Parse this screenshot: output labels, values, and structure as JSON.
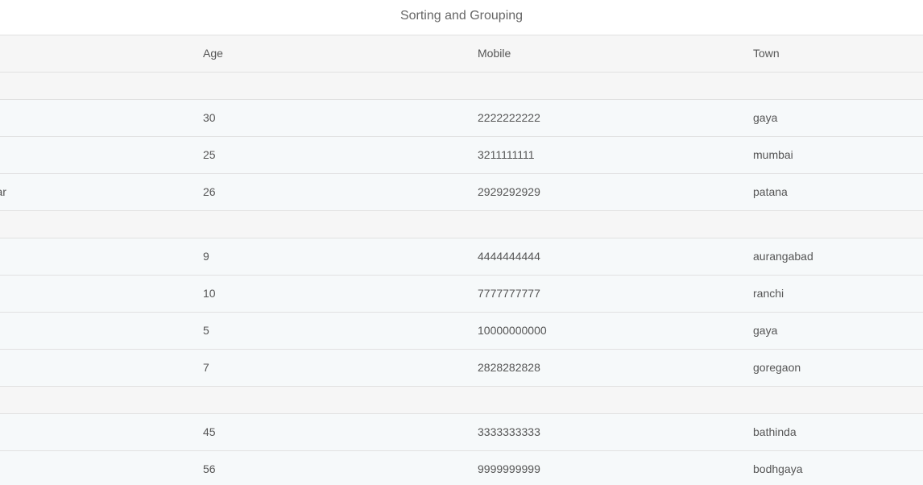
{
  "title": "Sorting and Grouping",
  "columns": {
    "age": "Age",
    "mobile": "Mobile",
    "town": "Town"
  },
  "groups": [
    {
      "rows": [
        {
          "name": "",
          "age": "30",
          "mobile": "2222222222",
          "town": "gaya"
        },
        {
          "name": "",
          "age": "25",
          "mobile": "3211111111",
          "town": "mumbai"
        },
        {
          "name": "kumar",
          "age": "26",
          "mobile": "2929292929",
          "town": "patana"
        }
      ]
    },
    {
      "rows": [
        {
          "name": "",
          "age": "9",
          "mobile": "4444444444",
          "town": "aurangabad"
        },
        {
          "name": "",
          "age": "10",
          "mobile": "7777777777",
          "town": "ranchi"
        },
        {
          "name": "",
          "age": "5",
          "mobile": "10000000000",
          "town": "gaya"
        },
        {
          "name": "",
          "age": "7",
          "mobile": "2828282828",
          "town": "goregaon"
        }
      ]
    },
    {
      "rows": [
        {
          "name": "",
          "age": "45",
          "mobile": "3333333333",
          "town": "bathinda"
        },
        {
          "name": "",
          "age": "56",
          "mobile": "9999999999",
          "town": "bodhgaya"
        }
      ]
    }
  ]
}
